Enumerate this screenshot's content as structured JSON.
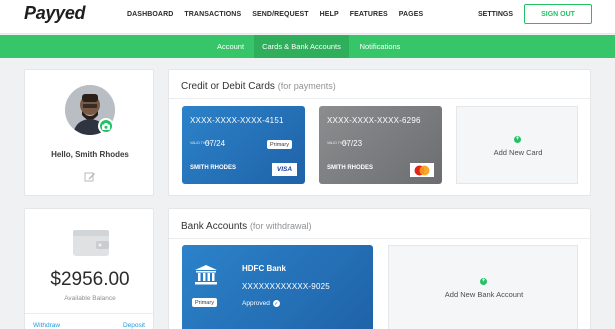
{
  "header": {
    "logo": "Payyed",
    "nav": [
      "DASHBOARD",
      "TRANSACTIONS",
      "SEND/REQUEST",
      "HELP",
      "FEATURES",
      "PAGES"
    ],
    "settings": "SETTINGS",
    "signout": "SIGN OUT"
  },
  "subnav": {
    "tabs": [
      "Account",
      "Cards & Bank Accounts",
      "Notifications"
    ],
    "active": "Cards & Bank Accounts"
  },
  "profile": {
    "greeting": "Hello, Smith Rhodes"
  },
  "balance": {
    "amount": "$2956.00",
    "label": "Available Balance",
    "withdraw": "Withdraw",
    "deposit": "Deposit"
  },
  "cards": {
    "title": "Credit or Debit Cards",
    "subtitle": "(for payments)",
    "items": [
      {
        "number": "XXXX-XXXX-XXXX-4151",
        "valid_label": "VALID THRU",
        "expiry": "07/24",
        "name": "SMITH RHODES",
        "badge": "Primary",
        "network": "VISA"
      },
      {
        "number": "XXXX-XXXX-XXXX-6296",
        "valid_label": "VALID THRU",
        "expiry": "07/23",
        "name": "SMITH RHODES",
        "badge": "",
        "network": "mastercard"
      }
    ],
    "add_label": "Add New Card",
    "add_symbol": "+"
  },
  "bank": {
    "title": "Bank Accounts",
    "subtitle": "(for withdrawal)",
    "account": {
      "name": "HDFC Bank",
      "number": "XXXXXXXXXXXX-9025",
      "badge": "Primary",
      "status": "Approved",
      "check_symbol": "✓"
    },
    "add_label": "Add New Bank Account",
    "add_symbol": "+"
  },
  "colors": {
    "brand_green": "#37c56a",
    "card_blue": "#2c82c9",
    "card_grey": "#7b7d80",
    "link_blue": "#1e9cdc"
  }
}
